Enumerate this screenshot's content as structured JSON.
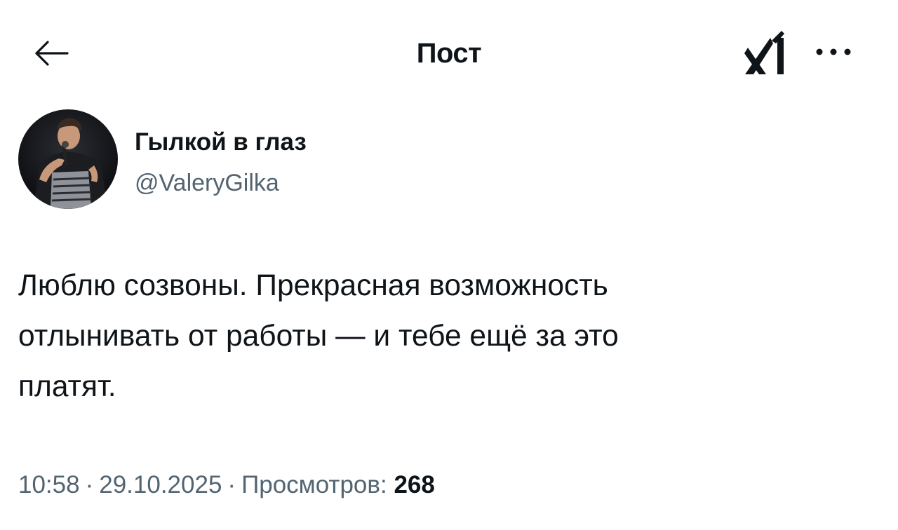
{
  "header": {
    "title": "Пост",
    "back_icon": "arrow-left-icon",
    "grok_icon": "grok-logo-icon",
    "more_icon": "more-horizontal-icon"
  },
  "author": {
    "display_name": "Гылкой в глаз",
    "handle": "@ValeryGilka",
    "avatar": "avatar-photo"
  },
  "tweet": {
    "lines": [
      "Люблю созвоны. Прекрасная возможность",
      "отлынивать от работы — и тебе ещё за это",
      "платят."
    ]
  },
  "meta": {
    "time": "10:58",
    "separator": "·",
    "date": "29.10.2025",
    "views_label": "Просмотров:",
    "views_count": "268"
  },
  "colors": {
    "text": "#0f1419",
    "secondary": "#536471",
    "background": "#ffffff"
  }
}
